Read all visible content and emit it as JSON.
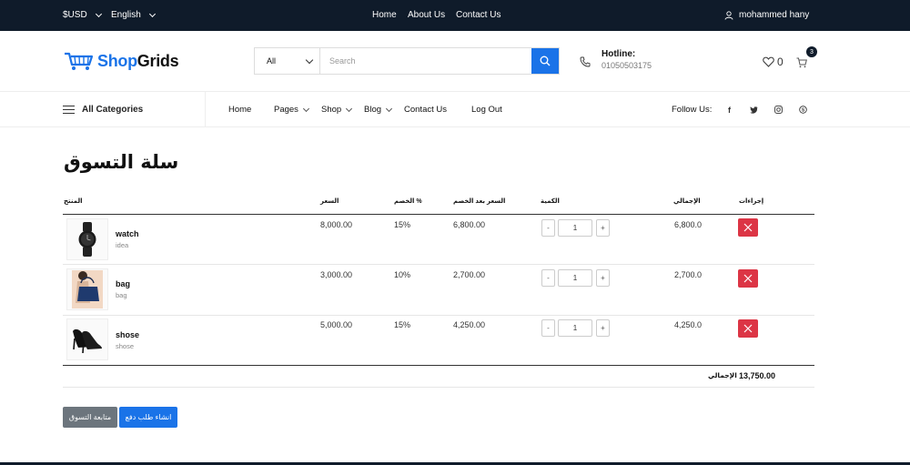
{
  "topbar": {
    "currency": "$USD",
    "language": "English",
    "links": [
      "Home",
      "About Us",
      "Contact Us"
    ],
    "user": "mohammed hany"
  },
  "header": {
    "logo_part1": "Shop",
    "logo_part2": "Grids",
    "search": {
      "category": "All",
      "placeholder": "Search"
    },
    "hotline_label": "Hotline:",
    "hotline_number": "01050503175",
    "wishlist_count": "0",
    "cart_count": "3"
  },
  "nav": {
    "all_categories": "All Categories",
    "links": [
      "Home",
      "Pages",
      "Shop",
      "Blog",
      "Contact Us",
      "Log Out"
    ],
    "follow_label": "Follow Us:",
    "social_icons": [
      "facebook-icon",
      "twitter-icon",
      "instagram-icon",
      "skype-icon"
    ]
  },
  "cart": {
    "title": "سلة التسوق",
    "headers": {
      "product": "المنتج",
      "price": "السعر",
      "discount": "% الخصم",
      "price_after": "السعر بعد الخصم",
      "quantity": "الكمية",
      "total": "الإجمالي",
      "actions": "إجراءات"
    },
    "items": [
      {
        "name": "watch",
        "category": "idea",
        "price": "8,000.00",
        "discount": "15%",
        "price_after": "6,800.00",
        "qty": "1",
        "total": "6,800.0"
      },
      {
        "name": "bag",
        "category": "bag",
        "price": "3,000.00",
        "discount": "10%",
        "price_after": "2,700.00",
        "qty": "1",
        "total": "2,700.0"
      },
      {
        "name": "shose",
        "category": "shose",
        "price": "5,000.00",
        "discount": "15%",
        "price_after": "4,250.00",
        "qty": "1",
        "total": "4,250.0"
      }
    ],
    "qty_minus": "-",
    "qty_plus": "+",
    "grand_total_label": "الإجمالي",
    "grand_total": "13,750.00",
    "continue_shopping": "متابعة التسوق",
    "create_payment": "انشاء طلب دفع"
  },
  "colors": {
    "topbar_bg": "#0f1b2a",
    "accent": "#1a73e8",
    "danger": "#dc3545",
    "secondary": "#6c757d"
  }
}
